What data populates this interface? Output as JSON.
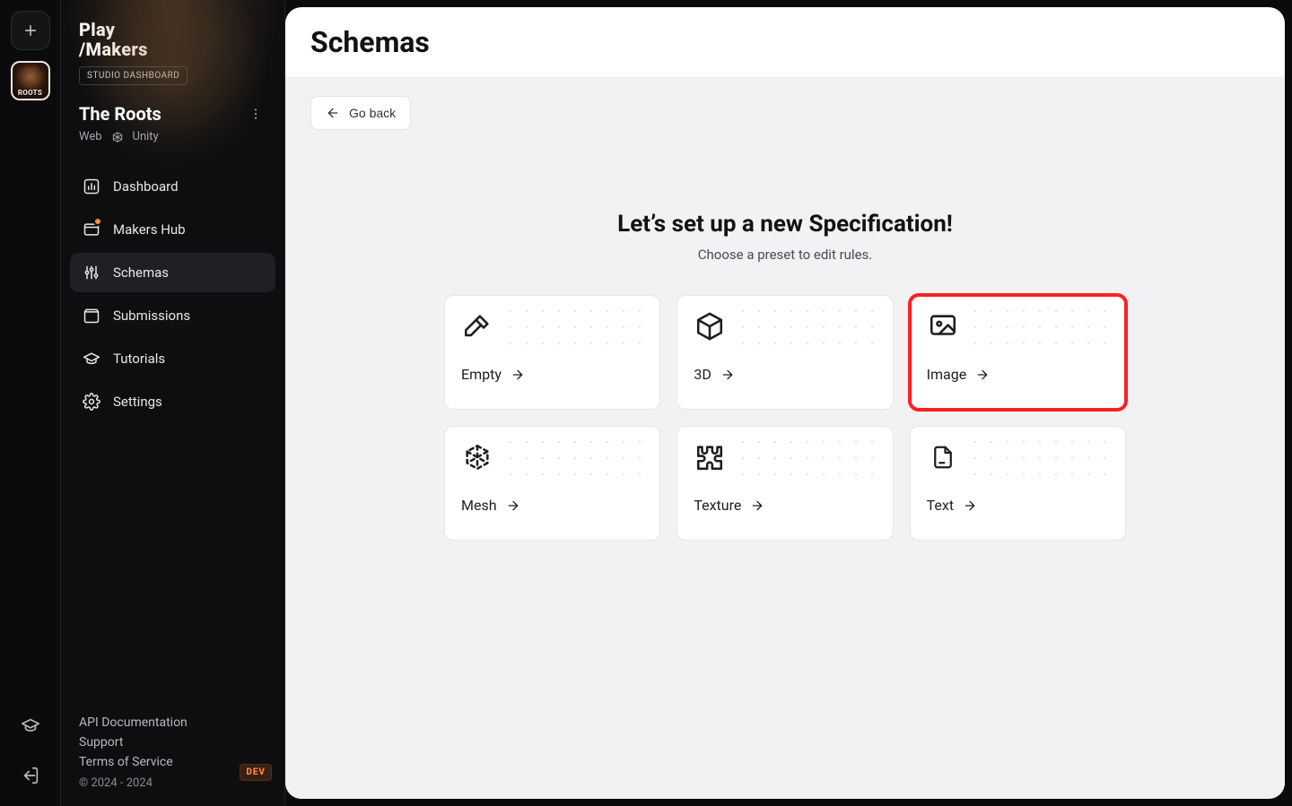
{
  "brand": {
    "line1": "Play",
    "line2": "/Makers",
    "badge": "STUDIO DASHBOARD"
  },
  "project": {
    "name": "The Roots",
    "platform": "Web",
    "engine": "Unity",
    "thumb_label": "ROOTS"
  },
  "nav": {
    "dashboard": "Dashboard",
    "makers_hub": "Makers Hub",
    "schemas": "Schemas",
    "submissions": "Submissions",
    "tutorials": "Tutorials",
    "settings": "Settings"
  },
  "footer": {
    "api_docs": "API Documentation",
    "support": "Support",
    "tos": "Terms of Service",
    "copyright": "© 2024 - 2024",
    "dev_label": "DEV"
  },
  "page": {
    "title": "Schemas",
    "go_back": "Go back",
    "headline": "Let’s set up a new Specification!",
    "subhead": "Choose a preset to edit rules."
  },
  "presets": [
    {
      "key": "empty",
      "label": "Empty"
    },
    {
      "key": "3d",
      "label": "3D"
    },
    {
      "key": "image",
      "label": "Image"
    },
    {
      "key": "mesh",
      "label": "Mesh"
    },
    {
      "key": "texture",
      "label": "Texture"
    },
    {
      "key": "text",
      "label": "Text"
    }
  ]
}
